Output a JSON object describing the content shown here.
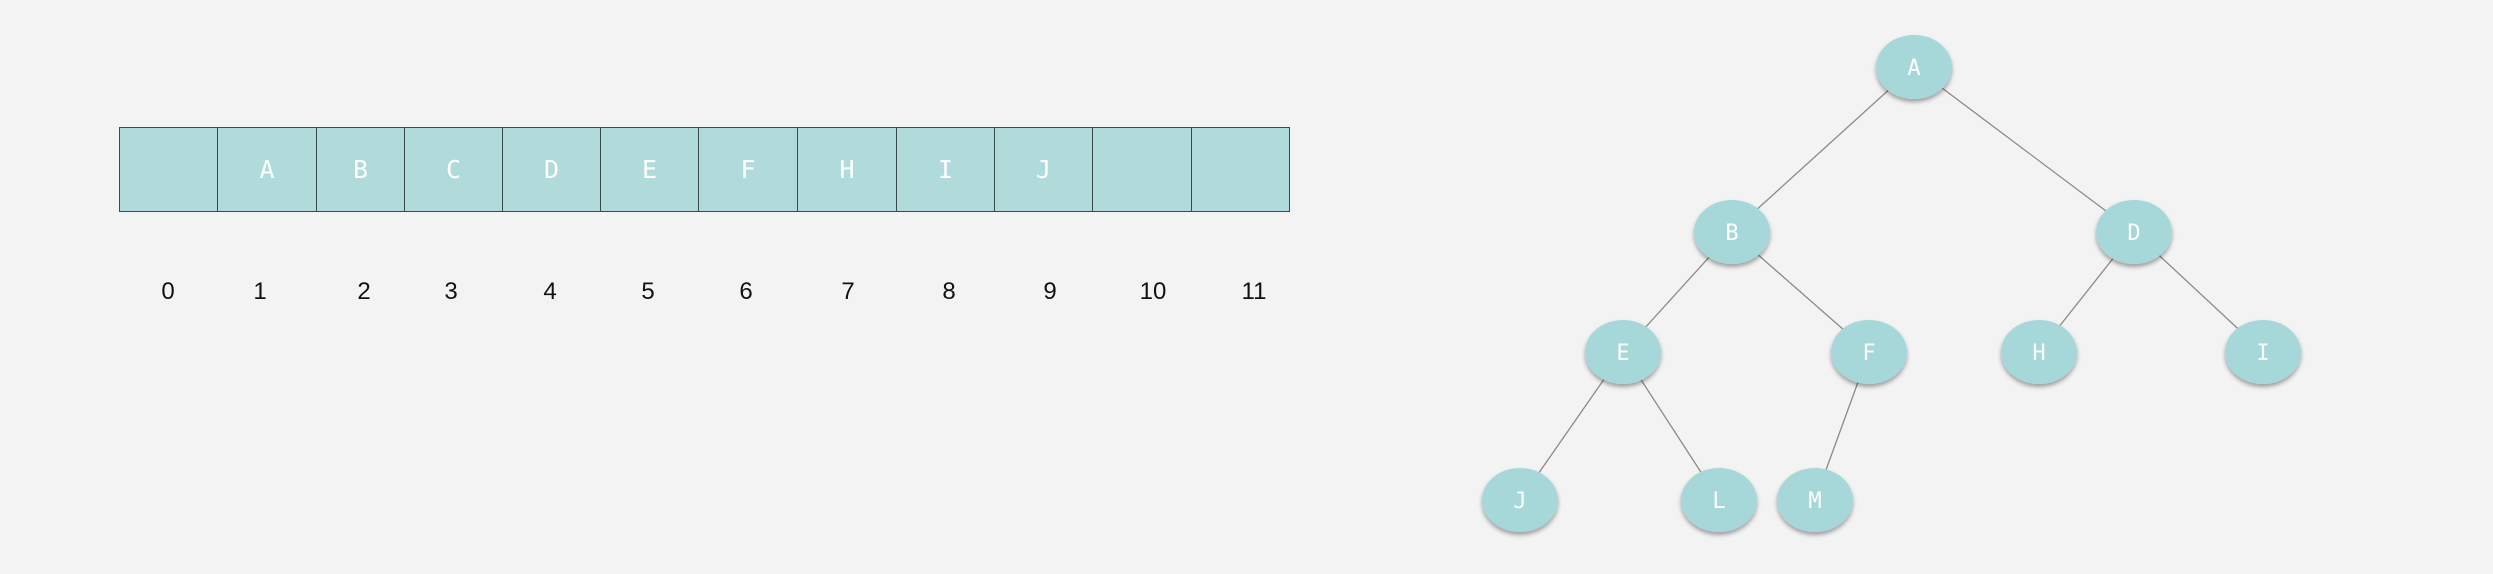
{
  "array": {
    "cells": [
      "",
      "A",
      "B",
      "C",
      "D",
      "E",
      "F",
      "H",
      "I",
      "J",
      "",
      ""
    ],
    "indices": [
      "0",
      "1",
      "2",
      "3",
      "4",
      "5",
      "6",
      "7",
      "8",
      "9",
      "10",
      "11"
    ]
  },
  "tree": {
    "nodes": [
      {
        "id": "A",
        "label": "A"
      },
      {
        "id": "B",
        "label": "B"
      },
      {
        "id": "D",
        "label": "D"
      },
      {
        "id": "E",
        "label": "E"
      },
      {
        "id": "F",
        "label": "F"
      },
      {
        "id": "H",
        "label": "H"
      },
      {
        "id": "I",
        "label": "I"
      },
      {
        "id": "J",
        "label": "J"
      },
      {
        "id": "L",
        "label": "L"
      },
      {
        "id": "M",
        "label": "M"
      }
    ],
    "edges": [
      [
        "A",
        "B"
      ],
      [
        "A",
        "D"
      ],
      [
        "B",
        "E"
      ],
      [
        "B",
        "F"
      ],
      [
        "D",
        "H"
      ],
      [
        "D",
        "I"
      ],
      [
        "E",
        "J"
      ],
      [
        "E",
        "L"
      ],
      [
        "F",
        "M"
      ]
    ]
  },
  "colors": {
    "cell_fill": "#b1dadb",
    "node_fill": "#a6d8d9",
    "edge": "#8a8a8a",
    "text": "#ffffff"
  }
}
